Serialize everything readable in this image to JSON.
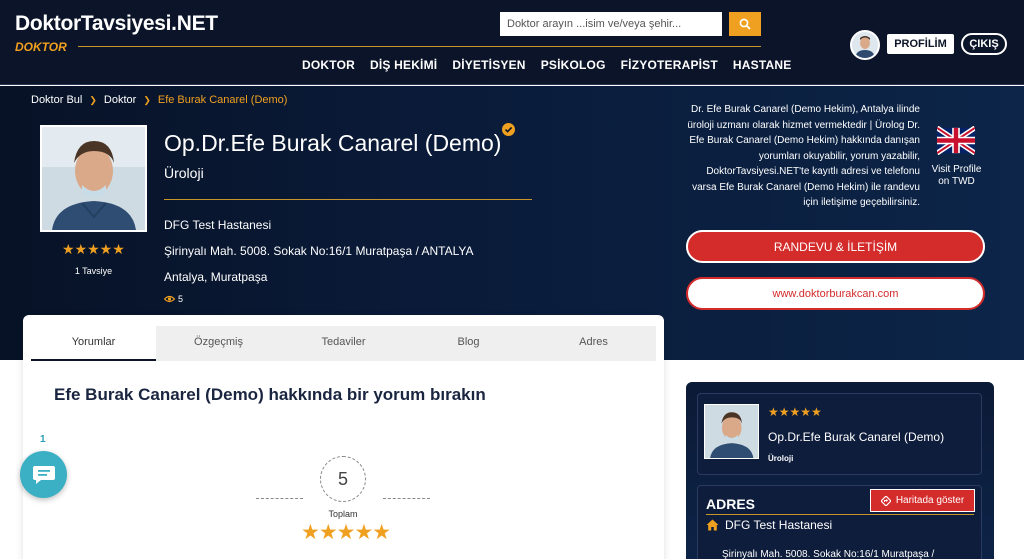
{
  "header": {
    "logo": "DoktorTavsiyesi.NET",
    "logo_sub": "DOKTOR",
    "search_placeholder": "Doktor arayın ...isim ve/veya şehir...",
    "nav": [
      "DOKTOR",
      "DİŞ HEKİMİ",
      "DİYETİSYEN",
      "PSİKOLOG",
      "FİZYOTERAPİST",
      "HASTANE"
    ],
    "profile_label": "PROFİLİM",
    "logout_label": "ÇIKIŞ"
  },
  "breadcrumb": [
    "Doktor Bul",
    "Doktor",
    "Efe Burak Canarel (Demo)"
  ],
  "doctor": {
    "name": "Op.Dr.Efe Burak Canarel (Demo)",
    "specialty": "Üroloji",
    "hospital": "DFG Test Hastanesi",
    "address": "Şirinyalı Mah. 5008. Sokak No:16/1 Muratpaşa / ANTALYA",
    "city": "Antalya, Muratpaşa",
    "views": "5",
    "stars": "★★★★★",
    "recommendations": "1 Tavsiye"
  },
  "description": "Dr. Efe Burak Canarel (Demo Hekim), Antalya ilinde üroloji uzmanı olarak hizmet vermektedir | Ürolog Dr. Efe Burak Canarel (Demo Hekim) hakkında danışan yorumları okuyabilir, yorum yazabilir, DoktorTavsiyesi.NET'te kayıtlı adresi ve telefonu varsa Efe Burak Canarel (Demo Hekim) ile randevu için iletişime geçebilirsiniz.",
  "visit_twd": "Visit Profile on TWD",
  "buttons": {
    "appointment": "RANDEVU & İLETİŞİM",
    "website": "www.doktorburakcan.com"
  },
  "tabs": [
    "Yorumlar",
    "Özgeçmiş",
    "Tedaviler",
    "Blog",
    "Adres"
  ],
  "review": {
    "title": "Efe Burak Canarel (Demo) hakkında bir yorum bırakın",
    "score": "5",
    "total_label": "Toplam",
    "stars": "★★★★★"
  },
  "chat": {
    "badge": "1"
  },
  "sidebar": {
    "stars": "★★★★★",
    "name": "Op.Dr.Efe Burak Canarel (Demo)",
    "specialty": "Üroloji",
    "adres_title": "ADRES",
    "map_button": "Haritada göster",
    "hospital": "DFG Test Hastanesi",
    "street": "Şirinyalı Mah. 5008. Sokak No:16/1 Muratpaşa /"
  },
  "colors": {
    "navy": "#0b1428",
    "accent": "#f0a020",
    "red": "#d42b2b",
    "chat": "#3bb0c4"
  }
}
